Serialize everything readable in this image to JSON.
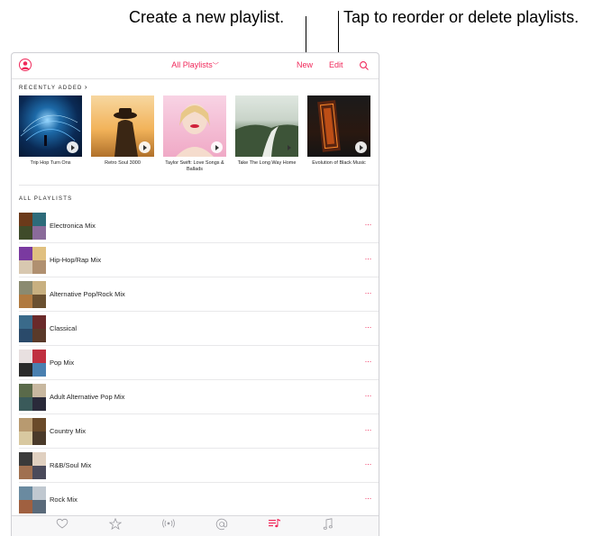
{
  "callouts": {
    "new": "Create a new playlist.",
    "edit": "Tap to reorder or delete playlists."
  },
  "navbar": {
    "title": "All Playlists",
    "new_label": "New",
    "edit_label": "Edit"
  },
  "recently_added": {
    "header": "RECENTLY ADDED",
    "albums": [
      {
        "title": "Trip Hop Turn Ons"
      },
      {
        "title": "Retro Soul 3000"
      },
      {
        "title": "Taylor Swift: Love Songs & Ballads"
      },
      {
        "title": "Take The Long Way Home"
      },
      {
        "title": "Evolution of Black Music"
      }
    ]
  },
  "all_playlists": {
    "header": "ALL PLAYLISTS",
    "items": [
      {
        "name": "Electronica Mix"
      },
      {
        "name": "Hip-Hop/Rap Mix"
      },
      {
        "name": "Alternative Pop/Rock Mix"
      },
      {
        "name": "Classical"
      },
      {
        "name": "Pop Mix"
      },
      {
        "name": "Adult Alternative Pop Mix"
      },
      {
        "name": "Country Mix"
      },
      {
        "name": "R&B/Soul Mix"
      },
      {
        "name": "Rock Mix"
      }
    ],
    "more_label": "···"
  },
  "tabbar": {
    "tabs": [
      {
        "icon": "heart-icon"
      },
      {
        "icon": "star-icon"
      },
      {
        "icon": "radio-icon"
      },
      {
        "icon": "at-icon"
      },
      {
        "icon": "playlist-icon",
        "active": true
      },
      {
        "icon": "music-note-icon"
      }
    ]
  },
  "colors": {
    "accent": "#f0285a"
  }
}
